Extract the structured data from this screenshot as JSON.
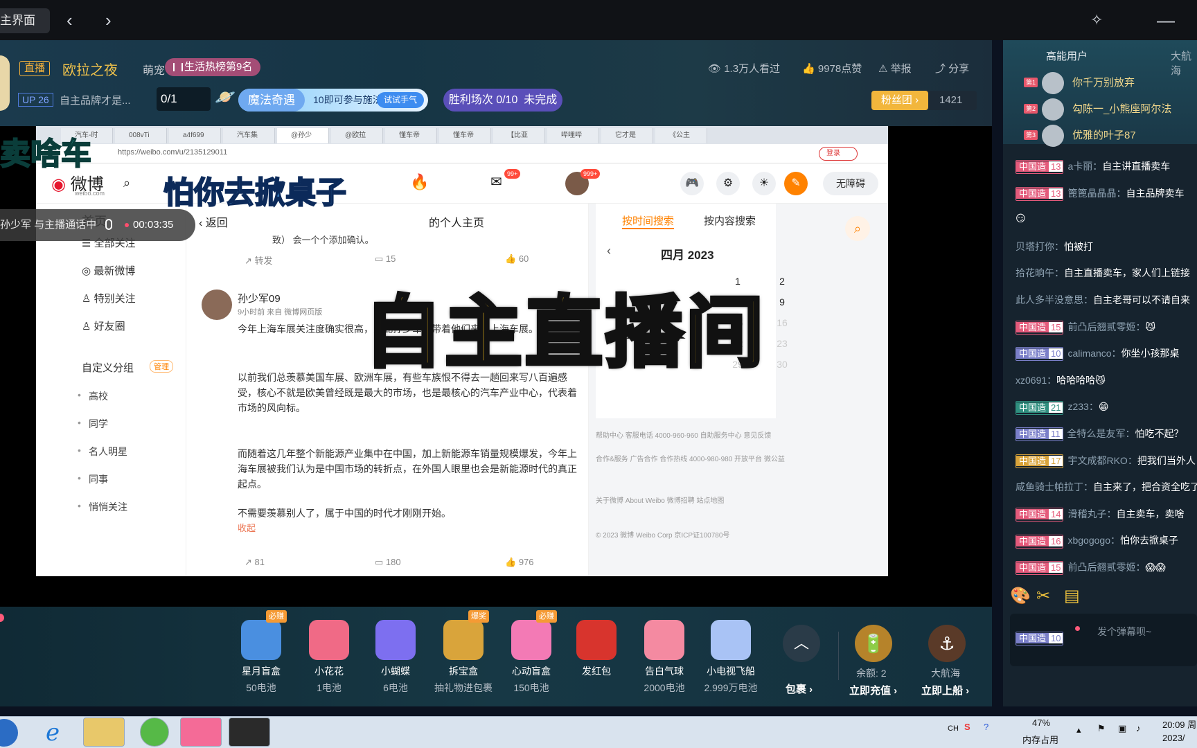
{
  "topbar": {
    "tab_label": "主界面",
    "back_icon": "chevron-left",
    "forward_icon": "chevron-right",
    "pin_icon": "pin",
    "minimize_icon": "minimize"
  },
  "room": {
    "live_badge": "直播",
    "title": "欧拉之夜",
    "category": "萌宠",
    "rank": "生活热榜第9名",
    "views": "1.3万人看过",
    "likes": "9978点赞",
    "report": "举报",
    "share": "分享",
    "up_level": "UP 26",
    "up_desc": "自主品牌才是...",
    "score": "0/1",
    "magic_name": "魔法奇遇",
    "magic_desc": "10即可参与施法",
    "magic_btn": "试试手气",
    "win_label": "胜利场次 0/10",
    "win_status": "未完成",
    "fans_label": "粉丝团",
    "fans_count": "1421"
  },
  "overlay": {
    "sticker1": "卖啥车",
    "sticker2": "怕你去掀桌子",
    "big_text": "自主直播间",
    "call_name": "孙少军 与主播通话中",
    "call_time": "00:03:35",
    "emoji": "😱😱"
  },
  "browser": {
    "tabs": [
      "汽车-时",
      "008vTi",
      "a4f699",
      "汽车集",
      "@孙少",
      "@欧拉",
      "懂车帝",
      "懂车帝",
      "【比亚",
      "哔哩哔",
      "它才是",
      "《公主"
    ],
    "url": "https://weibo.com/u/2135129011",
    "login": "登录"
  },
  "weibo": {
    "logo": "微博",
    "logo_sub": "weibo.com",
    "msg_badge": "99+",
    "avatar_badge": "999+",
    "accessibility": "无障碍",
    "home": "首页",
    "back": "返回",
    "profile_title": "的个人主页",
    "nav": [
      "全部关注",
      "最新微博",
      "特别关注",
      "好友圈"
    ],
    "custom_group": "自定义分组",
    "manage": "管理",
    "groups": [
      "高校",
      "同学",
      "名人明星",
      "同事",
      "悄悄关注"
    ],
    "post_prev": "致）  会一个个添加确认。",
    "repost": "转发",
    "comments": "15",
    "prev_likes": "60",
    "author": "孙少军09",
    "post_time": "9小时前 来自 微博网页版",
    "p1": "今年上海车展关注度确实很高，为此孙少军也带着他们来看上海车展。",
    "p2": "以前我们总羡慕美国车展、欧洲车展，有些车族恨不得去一趟回来写八百遍感受，核心不就是欧美曾经既是最大的市场，也是最核心的汽车产业中心，代表着市场的风向标。",
    "p3": "而随着这几年整个新能源产业集中在中国，加上新能源车销量规模爆发，今年上海车展被我们认为是中国市场的转折点，在外国人眼里也会是新能源时代的真正起点。",
    "p4": "不需要羡慕别人了，属于中国的时代才刚刚开始。",
    "p4_more": "收起",
    "f_repost": "81",
    "f_comment": "180",
    "f_like": "976",
    "search_time": "按时间搜索",
    "search_content": "按内容搜索",
    "cal_month": "四月 2023",
    "cal_days": [
      [
        "1",
        "2"
      ],
      [
        "8",
        "9"
      ],
      [
        "15",
        "16"
      ],
      [
        "22",
        "23"
      ],
      [
        "29",
        "30"
      ]
    ],
    "footer1": "帮助中心   客服电话 4000-960-960   自助服务中心   意见反馈",
    "footer2": "合作&服务   广告合作   合作热线 4000-980-980   开放平台   微公益",
    "footer3": "关于微博   About Weibo   微博招聘   站点地图",
    "footer4": "© 2023 微博 Weibo Corp 京ICP证100780号"
  },
  "gifts": [
    {
      "name": "星月盲盒",
      "price": "50电池",
      "tag": "必赚",
      "color": "#4a8fe0"
    },
    {
      "name": "小花花",
      "price": "1电池",
      "tag": "",
      "color": "#f06a86"
    },
    {
      "name": "小蝴蝶",
      "price": "6电池",
      "tag": "",
      "color": "#7d6ff0"
    },
    {
      "name": "拆宝盒",
      "price": "抽礼物进包裹",
      "tag": "爆奖",
      "color": "#d9a43b"
    },
    {
      "name": "心动盲盒",
      "price": "150电池",
      "tag": "必赚",
      "color": "#f37ab5"
    },
    {
      "name": "发红包",
      "price": "",
      "tag": "",
      "color": "#d8342d"
    },
    {
      "name": "告白气球",
      "price": "2000电池",
      "tag": "",
      "color": "#f48aa1"
    },
    {
      "name": "小电视飞船",
      "price": "2.999万电池",
      "tag": "",
      "color": "#a9c3f5"
    }
  ],
  "giftbar": {
    "pack": "包裹",
    "balance": "余额: 2",
    "recharge": "立即充值",
    "fleet": "大航海",
    "board": "立即上船"
  },
  "sidebar": {
    "tab1": "高能用户",
    "tab2": "大航海",
    "high_users": [
      {
        "rank": "第1",
        "name": "你千万别放弃"
      },
      {
        "rank": "第2",
        "name": "勾陈一_小熊座阿尔法"
      },
      {
        "rank": "第3",
        "name": "优雅的叶子87"
      }
    ],
    "messages": [
      {
        "medal": "中国造",
        "level": "13",
        "mcolor": "#e45a7b",
        "user": "a卡丽：",
        "text": "自主讲直播卖车"
      },
      {
        "medal": "中国造",
        "level": "13",
        "mcolor": "#e45a7b",
        "user": "篦篦晶晶晶：",
        "text": "自主品牌卖车"
      },
      {
        "medal": "",
        "level": "",
        "mcolor": "",
        "user": "",
        "text": "😏"
      },
      {
        "medal": "",
        "level": "",
        "mcolor": "",
        "user": "贝塔打你：",
        "text": "怕被打"
      },
      {
        "medal": "",
        "level": "",
        "mcolor": "",
        "user": "拾花晌午：",
        "text": "自主直播卖车，家人们上链接"
      },
      {
        "medal": "",
        "level": "",
        "mcolor": "",
        "user": "此人多半没意思：",
        "text": "自主老哥可以不请自来"
      },
      {
        "medal": "中国造",
        "level": "15",
        "mcolor": "#e45a7b",
        "user": "前凸后翘贰零姬：",
        "text": "😼"
      },
      {
        "medal": "中国造",
        "level": "10",
        "mcolor": "#7a7fc9",
        "user": "calimanco：",
        "text": "你坐小孩那桌"
      },
      {
        "medal": "",
        "level": "",
        "mcolor": "",
        "user": "xz0691：",
        "text": "哈哈哈哈😼"
      },
      {
        "medal": "中国造",
        "level": "21",
        "mcolor": "#2f8f7f",
        "user": "z233：",
        "text": "😁"
      },
      {
        "medal": "中国造",
        "level": "11",
        "mcolor": "#7a7fc9",
        "user": "全特么是友军：",
        "text": "怕吃不起？"
      },
      {
        "medal": "中国造",
        "level": "17",
        "mcolor": "#d9a43b",
        "user": "宇文成都RKO：",
        "text": "把我们当外人"
      },
      {
        "medal": "",
        "level": "",
        "mcolor": "",
        "user": "咸鱼骑士帕拉丁：",
        "text": "自主来了，把合资全吃了"
      },
      {
        "medal": "中国造",
        "level": "14",
        "mcolor": "#e45a7b",
        "user": "滑稽丸子：",
        "text": "自主卖车，卖啥"
      },
      {
        "medal": "中国造",
        "level": "16",
        "mcolor": "#e45a7b",
        "user": "xbgogogo：",
        "text": "怕你去掀桌子"
      },
      {
        "medal": "中国造",
        "level": "15",
        "mcolor": "#e45a7b",
        "user": "前凸后翘贰零姬：",
        "text": "😱😱"
      }
    ],
    "input_medal": "中国造",
    "input_level": "10",
    "input_placeholder": "发个弹幕呗~"
  },
  "taskbar": {
    "ime": "CH",
    "mem_percent": "47%",
    "mem_label": "内存占用",
    "time": "20:09 周",
    "date": "2023/"
  }
}
